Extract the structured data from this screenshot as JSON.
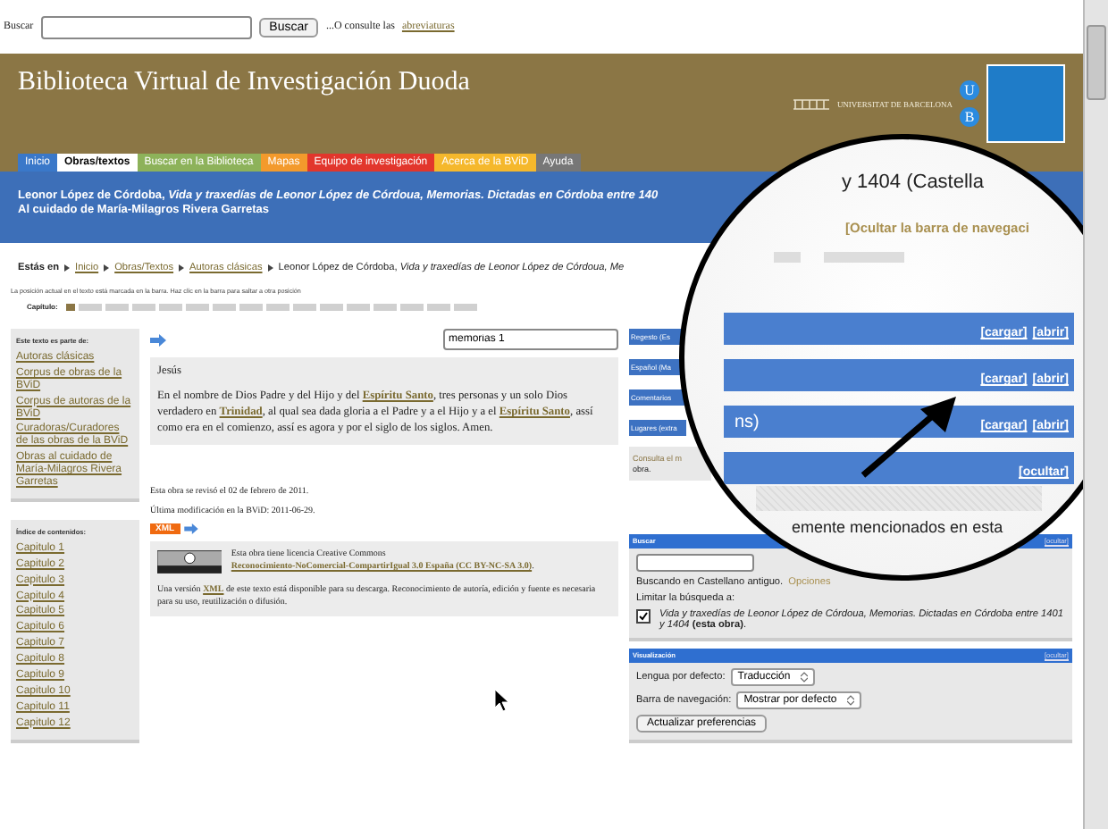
{
  "top_search": {
    "label": "Buscar",
    "button": "Buscar",
    "prefix": "...O consulte las",
    "link": "abreviaturas"
  },
  "header": {
    "title": "Biblioteca Virtual de Investigación Duoda",
    "ub_logo": {
      "letters": [
        "U",
        "B"
      ],
      "name": "UNIVERSITAT DE BARCELONA"
    }
  },
  "tabs": [
    {
      "label": "Inicio",
      "color": "#3a78c9",
      "selected": false
    },
    {
      "label": "Obras/textos",
      "color": "#ffffff",
      "selected": true
    },
    {
      "label": "Buscar en la Biblioteca",
      "color": "#8db25a",
      "selected": false
    },
    {
      "label": "Mapas",
      "color": "#f39a2c",
      "selected": false
    },
    {
      "label": "Equipo de investigación",
      "color": "#e2362c",
      "selected": false
    },
    {
      "label": "Acerca de la BViD",
      "color": "#f5b82c",
      "selected": false
    },
    {
      "label": "Ayuda",
      "color": "#777777",
      "selected": false
    }
  ],
  "banner": {
    "title": "Leonor López de Córdoba, *Vida y traxedías de Leonor López de Córdoua, Memorias. Dictadas en Córdoba entre 140*",
    "curator": "Al cuidado de María-Milagros Rivera Garretas"
  },
  "breadcrumb": {
    "label": "Estás en",
    "items": [
      {
        "text": "Inicio",
        "link": true
      },
      {
        "text": "Obras/Textos",
        "link": true
      },
      {
        "text": "Autoras clásicas",
        "link": true
      },
      {
        "text": "Leonor López de Córdoba, *Vida y traxedías de Leonor López de Córdoua, Me*",
        "link": false
      }
    ]
  },
  "position_note": "La posición actual en el texto está marcada en la barra. Haz clic en la barra para saltar a otra posición",
  "chapter_bar": {
    "label": "Capítulo:",
    "segments": [
      {
        "selected": true
      },
      {
        "selected": false
      },
      {
        "selected": false
      },
      {
        "selected": false
      },
      {
        "selected": false
      },
      {
        "selected": false
      },
      {
        "selected": false
      },
      {
        "selected": false
      },
      {
        "selected": false
      },
      {
        "selected": false
      },
      {
        "selected": false
      },
      {
        "selected": false
      },
      {
        "selected": false
      },
      {
        "selected": false
      },
      {
        "selected": false
      },
      {
        "selected": false
      }
    ]
  },
  "sidebar": {
    "part_of": {
      "heading": "Este texto es parte de:",
      "links": [
        "Autoras clásicas",
        "Corpus de obras de la BViD",
        "Corpus de autoras de la BViD",
        "Curadoras/Curadores de las obras de la BViD",
        "Obras al cuidado de María-Milagros Rivera Garretas"
      ]
    },
    "index": {
      "heading": "Índice de contenidos:",
      "links": [
        "Capitulo 1",
        "Capitulo 2",
        "Capitulo 3",
        "Capitulo 4",
        "Capitulo 5",
        "Capitulo 6",
        "Capitulo 7",
        "Capitulo 8",
        "Capitulo 9",
        "Capitulo 10",
        "Capitulo 11",
        "Capitulo 12"
      ]
    }
  },
  "main": {
    "section_field": {
      "value": "memorias 1"
    },
    "text": {
      "heading": "Jesús",
      "parts": [
        {
          "text": "En el nombre de Dios Padre y del Hijo y del ",
          "link": false
        },
        {
          "text": "Espíritu Santo",
          "link": true
        },
        {
          "text": ", tres personas y un solo Dios verdadero en ",
          "link": false
        },
        {
          "text": "Trinidad",
          "link": true
        },
        {
          "text": ", al qual sea dada gloria a el Padre y a el Hijo y a el ",
          "link": false
        },
        {
          "text": "Espíritu Santo",
          "link": true
        },
        {
          "text": ", assí como era en el comienzo, assí es agora y por el siglo de los siglos. Amen.",
          "link": false
        }
      ]
    },
    "revised": "Esta obra se revisó el 02 de febrero de 2011.",
    "modified": "Última modificación en la BViD: 2011-06-29.",
    "xml_badge": "XML",
    "license": {
      "parts": [
        {
          "text": "Esta obra tiene licencia Creative Commons ",
          "link": false
        },
        {
          "text": "Reconocimiento-NoComercial-CompartirIgual 3.0 España (CC BY-NC-SA 3.0)",
          "link": true
        },
        {
          "text": ".",
          "link": false
        }
      ],
      "download": [
        {
          "text": "Una versión ",
          "link": false
        },
        {
          "text": "XML",
          "link": true
        },
        {
          "text": " de este texto está disponible para su descarga. Reconocimiento de autoría, edición y fuente es necesaria para su uso, reutilización o difusión.",
          "link": false
        }
      ]
    }
  },
  "right_panel": {
    "layers": [
      "Regesto (Es",
      "Español (Ma",
      "Comentarios",
      "Lugares (extra"
    ],
    "note": [
      "Consulta el m",
      "obra."
    ],
    "search": {
      "title": "Buscar",
      "hide": "[ocultar]",
      "language_note": "Buscando en Castellano antiguo.",
      "options_link": "Opciones",
      "limit": "Limitar la búsqueda a:",
      "limit_checked": true,
      "limit_text": "*Vida y traxedías de Leonor López de Córdoua, Memorias. Dictadas en Córdoba entre 1401 y 1404* **(esta obra)**."
    },
    "display": {
      "title": "Visualización",
      "hide": "[ocultar]",
      "rows": [
        {
          "label": "Lengua por defecto:",
          "value": "Traducción"
        },
        {
          "label": "Barra de navegación:",
          "value": "Mostrar por defecto"
        }
      ],
      "button": "Actualizar preferencias"
    }
  },
  "magnifier": {
    "banner_text": "y 1404 (Castella",
    "hide_link": "[Ocultar la barra de navegaci",
    "bars": [
      {
        "links": [
          "[cargar]",
          "[abrir]"
        ]
      },
      {
        "links": [
          "[cargar]",
          "[abrir]"
        ]
      },
      {
        "text": "ns)",
        "links": [
          "[cargar]",
          "[abrir]"
        ]
      },
      {
        "links": [
          "[ocultar]"
        ]
      }
    ],
    "caption": "emente mencionados en esta"
  }
}
